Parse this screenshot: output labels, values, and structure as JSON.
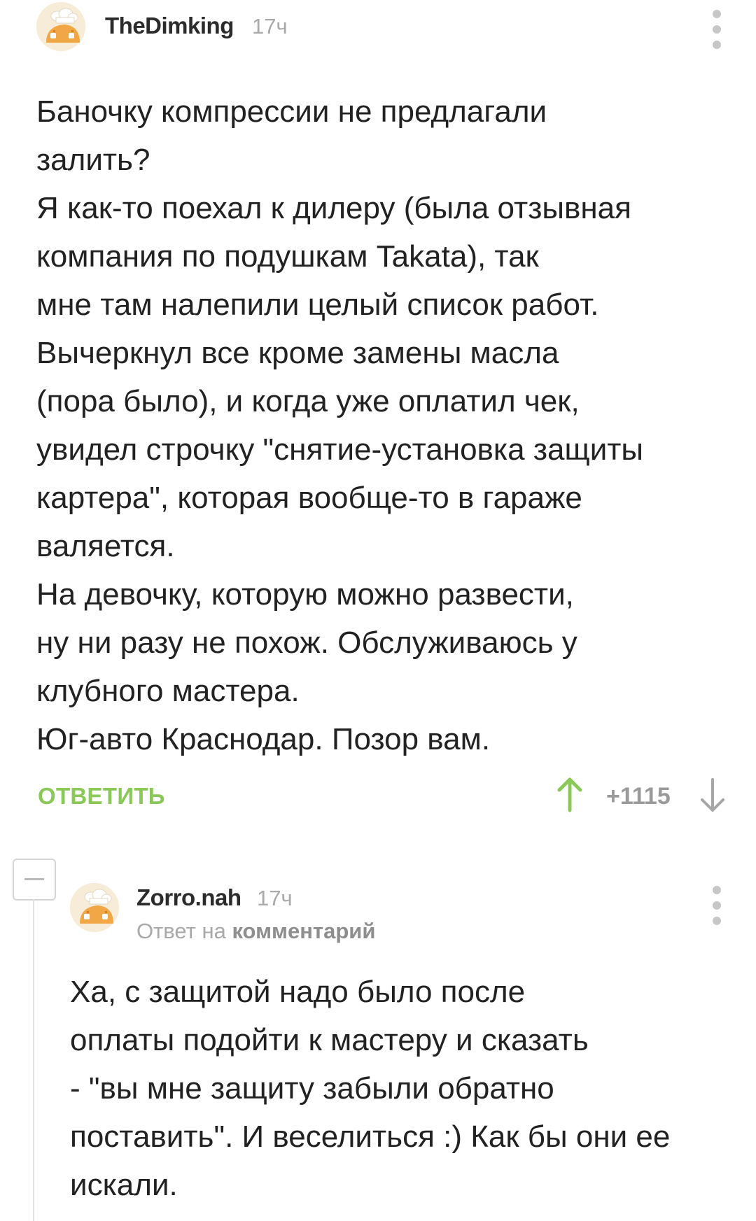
{
  "comment1": {
    "username": "TheDimking",
    "time": "17ч",
    "avatar_icon": "baker-avatar-icon",
    "body": "Баночку компрессии не предлагали\nзалить?\nЯ как-то поехал к дилеру (была отзывная\nкомпания по подушкам Takata), так\nмне там налепили целый список работ.\nВычеркнул все кроме замены масла\n(пора было), и когда уже оплатил чек,\nувидел строчку \"снятие-установка защиты\nкартера\", которая вообще-то в гараже\nваляется.\nНа девочку, которую можно развести,\nну ни разу не похож. Обслуживаюсь у\nклубного мастера.\nЮг-авто Краснодар. Позор вам.",
    "reply_label": "ОТВЕТИТЬ",
    "rating": "+1115"
  },
  "comment2": {
    "username": "Zorro.nah",
    "time": "17ч",
    "avatar_icon": "baker-avatar-icon",
    "reply_prefix": "Ответ на",
    "reply_target": "комментарий",
    "body": "Ха, с защитой  надо было  после\nоплаты  подойти к мастеру и сказать\n- \"вы мне защиту забыли обратно\nпоставить\". И веселиться :) Как бы они ее\nискали."
  },
  "colors": {
    "accent_green": "#8ac858",
    "muted_gray": "#a9a9a9",
    "text": "#222222"
  }
}
